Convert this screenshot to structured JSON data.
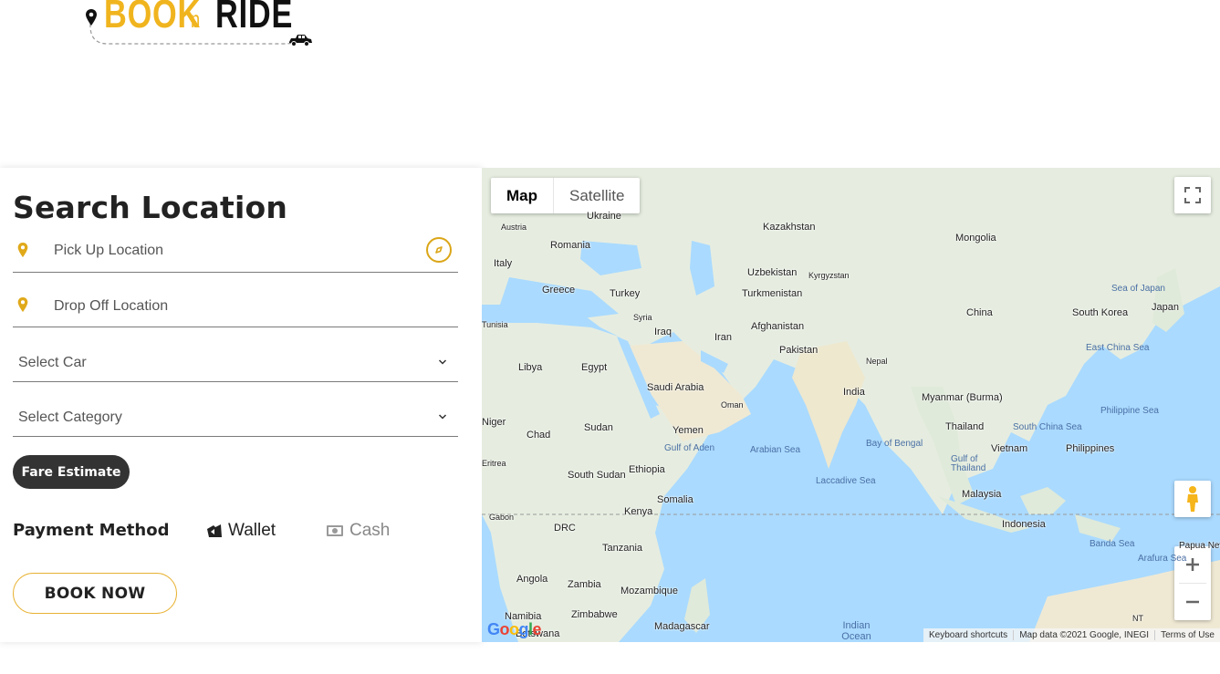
{
  "logo": {
    "word_book": "BOOK",
    "word_n": "n",
    "word_ride": "RIDE"
  },
  "form": {
    "title": "Search Location",
    "pickup_placeholder": "Pick Up Location",
    "dropoff_placeholder": "Drop Off Location",
    "select_car": "Select Car",
    "select_category": "Select Category",
    "fare_button": "Fare Estimate",
    "payment_label": "Payment Method",
    "payment_options": [
      "Wallet",
      "Cash"
    ],
    "book_button": "BOOK NOW"
  },
  "colors": {
    "accent": "#f0b41e",
    "dark": "#333333",
    "map_water": "#aadaff",
    "map_land": "#e8efe2"
  },
  "map": {
    "types": [
      "Map",
      "Satellite"
    ],
    "active_type": "Map",
    "labels": [
      "Ukraine",
      "Kazakhstan",
      "Mongolia",
      "Austria",
      "Romania",
      "Italy",
      "Greece",
      "Uzbekistan",
      "Kyrgyzstan",
      "Turkmenistan",
      "Turkey",
      "China",
      "Sea of Japan",
      "Japan",
      "South Korea",
      "Syria",
      "Iraq",
      "Iran",
      "Afghanistan",
      "Tunisia",
      "Libya",
      "Egypt",
      "Pakistan",
      "East China Sea",
      "Nepal",
      "Saudi Arabia",
      "Oman",
      "India",
      "Myanmar (Burma)",
      "Yemen",
      "Thailand",
      "Philippine Sea",
      "Niger",
      "Chad",
      "Sudan",
      "South China Sea",
      "Gulf of Aden",
      "Arabian Sea",
      "Bay of Bengal",
      "Vietnam",
      "Philippines",
      "Eritrea",
      "Ethiopia",
      "Gulf of Thailand",
      "South Sudan",
      "Laccadive Sea",
      "Somalia",
      "Malaysia",
      "Kenya",
      "Gabon",
      "DRC",
      "Indonesia",
      "Tanzania",
      "Banda Sea",
      "Papua New Guinea",
      "Angola",
      "Zambia",
      "Mozambique",
      "Arafura Sea",
      "Zimbabwe",
      "Namibia",
      "Madagascar",
      "Botswana",
      "NT",
      "Indian Ocean"
    ],
    "google": "Google",
    "attribution": [
      "Keyboard shortcuts",
      "Map data ©2021 Google, INEGI",
      "Terms of Use"
    ]
  },
  "icons": [
    "location-pin-icon",
    "compass-icon",
    "chevron-down-icon",
    "wallet-icon",
    "cash-icon",
    "fullscreen-icon",
    "pegman-icon",
    "zoom-in-icon",
    "zoom-out-icon",
    "taxi-icon"
  ]
}
